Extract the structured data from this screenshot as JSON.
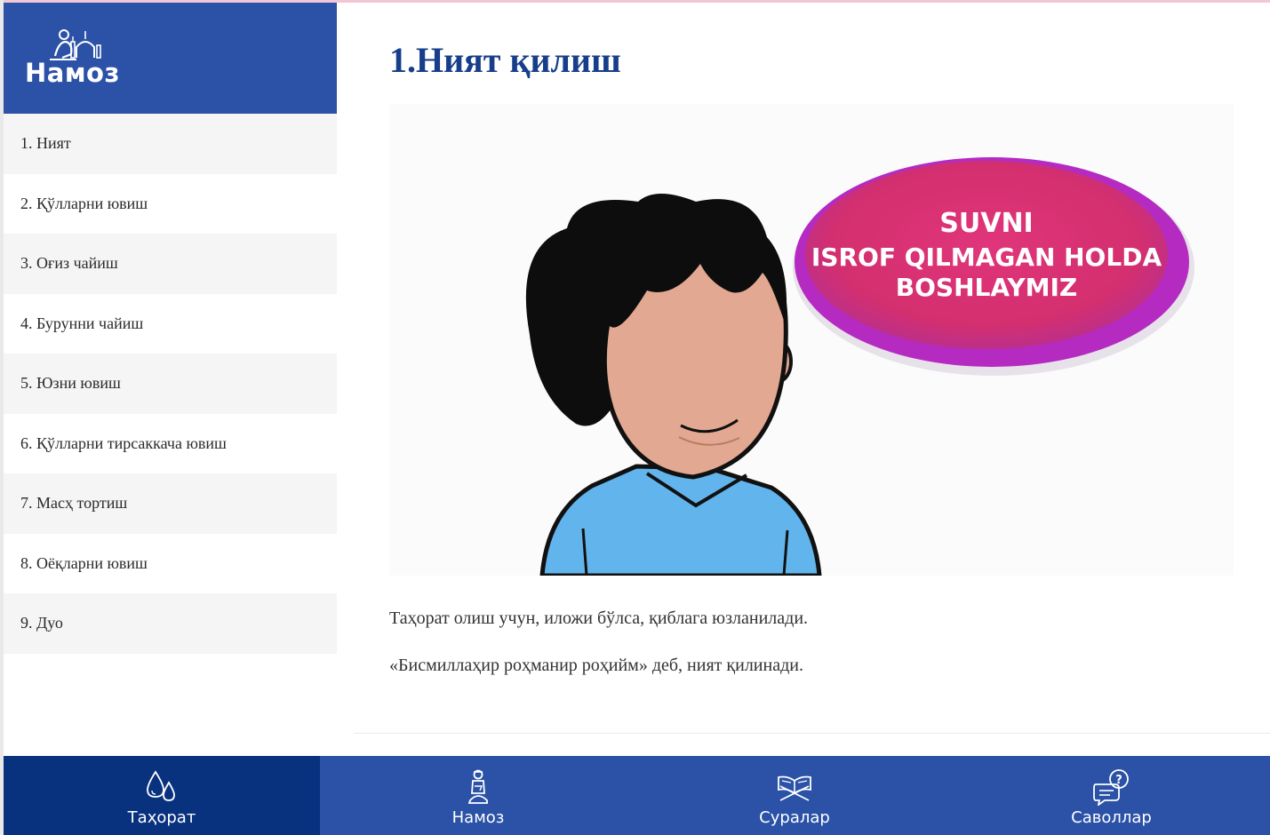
{
  "brand": {
    "logo_text": "Намоз"
  },
  "sidebar": {
    "items": [
      {
        "label": "1. Ният"
      },
      {
        "label": "2. Қўлларни ювиш"
      },
      {
        "label": "3. Оғиз чайиш"
      },
      {
        "label": "4. Бурунни чайиш"
      },
      {
        "label": "5. Юзни ювиш"
      },
      {
        "label": "6. Қўлларни тирсаккача ювиш"
      },
      {
        "label": "7. Масҳ тортиш"
      },
      {
        "label": "8. Оёқларни ювиш"
      },
      {
        "label": "9. Дуо"
      }
    ]
  },
  "main": {
    "title": "1.Ният қилиш",
    "illustration": {
      "bubble_lines": [
        "SUVNI",
        "ISROF QILMAGAN HOLDA",
        "BOSHLAYMIZ"
      ]
    },
    "paragraphs": [
      "Таҳорат олиш учун, иложи бўлса, қиблага юзланилади.",
      "«Бисмиллаҳир роҳманир роҳийм» деб, ният қилинади."
    ]
  },
  "bottom_nav": {
    "items": [
      {
        "label": "Таҳорат",
        "icon": "water-drops-icon",
        "active": true
      },
      {
        "label": "Намоз",
        "icon": "praying-person-icon",
        "active": false
      },
      {
        "label": "Суралар",
        "icon": "quran-stand-icon",
        "active": false
      },
      {
        "label": "Саволлар",
        "icon": "question-chat-icon",
        "active": false
      }
    ]
  },
  "colors": {
    "brand_blue": "#2b52a7",
    "active_nav": "#08317e",
    "title": "#173e8a",
    "bubble_pink": "#d8306c",
    "bubble_purple": "#b52bc2",
    "shirt_blue": "#62b4ec",
    "skin": "#e2a891"
  }
}
